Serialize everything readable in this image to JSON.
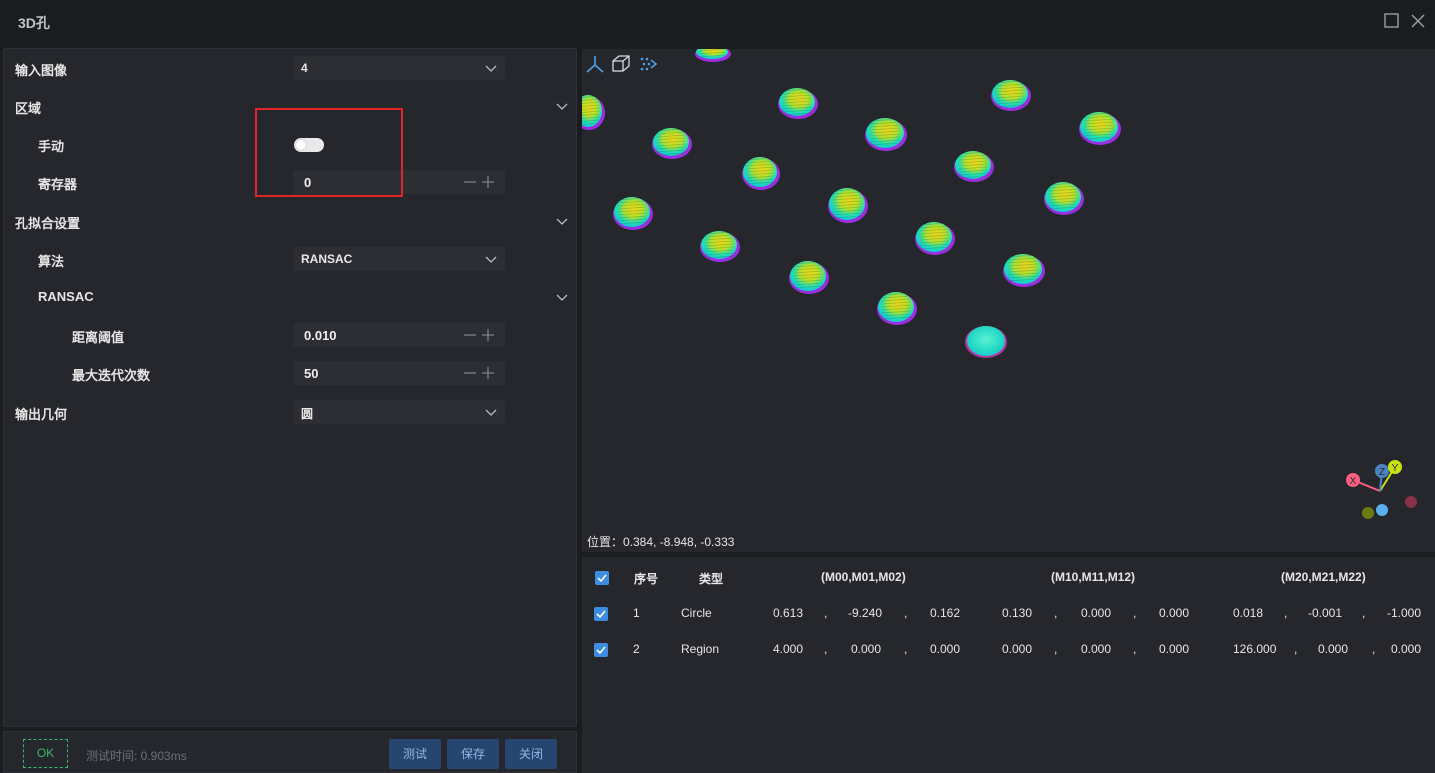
{
  "window": {
    "title": "3D孔"
  },
  "form": {
    "input_image": {
      "label": "输入图像",
      "value": "4"
    },
    "region": {
      "label": "区域"
    },
    "manual": {
      "label": "手动"
    },
    "register": {
      "label": "寄存器",
      "value": "0"
    },
    "hole_fit": {
      "label": "孔拟合设置"
    },
    "algorithm": {
      "label": "算法",
      "value": "RANSAC"
    },
    "ransac": {
      "label": "RANSAC"
    },
    "distance_threshold": {
      "label": "距离阈值",
      "value": "0.010"
    },
    "max_iterations": {
      "label": "最大迭代次数",
      "value": "50"
    },
    "output_geometry": {
      "label": "输出几何",
      "value": "圆"
    }
  },
  "footer": {
    "ok_label": "OK",
    "test_time": "测试时间: 0.903ms",
    "test_label": "测试",
    "save_label": "保存",
    "close_label": "关闭"
  },
  "viewer": {
    "position_readout": "位置：0.384, -8.948, -0.333",
    "axis_labels": {
      "x": "X",
      "y": "Y",
      "z": "Z"
    }
  },
  "table": {
    "headers": {
      "index": "序号",
      "type": "类型",
      "m0": "(M00,M01,M02)",
      "m1": "(M10,M11,M12)",
      "m2": "(M20,M21,M22)"
    },
    "rows": [
      {
        "index": "1",
        "type": "Circle",
        "values": [
          "0.613",
          "-9.240",
          "0.162",
          "0.130",
          "0.000",
          "0.000",
          "0.018",
          "-0.001",
          "-1.000"
        ]
      },
      {
        "index": "2",
        "type": "Region",
        "values": [
          "4.000",
          "0.000",
          "0.000",
          "0.000",
          "0.000",
          "0.000",
          "126.000",
          "0.000",
          "0.000"
        ]
      }
    ]
  },
  "colors": {
    "accent": "#3c8ddf",
    "annotation": "#e0242a",
    "ok": "#37b86b",
    "button": "#27466f"
  }
}
